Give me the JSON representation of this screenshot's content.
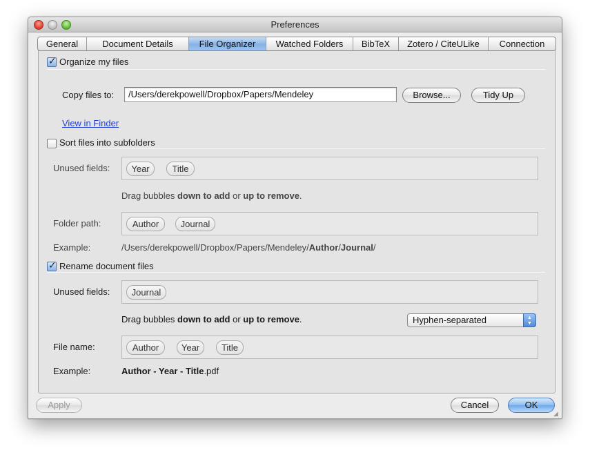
{
  "window": {
    "title": "Preferences"
  },
  "tabs": [
    {
      "label": "General"
    },
    {
      "label": "Document Details"
    },
    {
      "label": "File Organizer",
      "active": true
    },
    {
      "label": "Watched Folders"
    },
    {
      "label": "BibTeX"
    },
    {
      "label": "Zotero / CiteULike"
    },
    {
      "label": "Connection"
    }
  ],
  "organize": {
    "checkbox_label": "Organize my files",
    "checked": true,
    "copy_label": "Copy files to:",
    "copy_path": "/Users/derekpowell/Dropbox/Papers/Mendeley",
    "browse_label": "Browse...",
    "tidy_label": "Tidy Up",
    "view_link": "View in Finder"
  },
  "sort": {
    "checkbox_label": "Sort files into subfolders",
    "checked": false,
    "unused_label": "Unused fields:",
    "unused_fields": [
      "Year",
      "Title"
    ],
    "hint_prefix": "Drag bubbles ",
    "hint_add": "down to add",
    "hint_mid": " or ",
    "hint_remove": "up to remove",
    "hint_end": ".",
    "path_label": "Folder path:",
    "path_fields": [
      "Author",
      "Journal"
    ],
    "example_label": "Example:",
    "example_base": "/Users/derekpowell/Dropbox/Papers/Mendeley/",
    "example_author": "Author",
    "example_sep": "/",
    "example_journal": "Journal",
    "example_end": "/"
  },
  "rename": {
    "checkbox_label": "Rename document files",
    "checked": true,
    "unused_label": "Unused fields:",
    "unused_fields": [
      "Journal"
    ],
    "hint_prefix": "Drag bubbles ",
    "hint_add": "down to add",
    "hint_mid": " or ",
    "hint_remove": "up to remove",
    "hint_end": ".",
    "separator_value": "Hyphen-separated",
    "filename_label": "File name:",
    "filename_fields": [
      "Author",
      "Year",
      "Title"
    ],
    "example_label": "Example:",
    "example_bold": "Author - Year - Title",
    "example_ext": ".pdf"
  },
  "footer": {
    "apply_label": "Apply",
    "cancel_label": "Cancel",
    "ok_label": "OK"
  },
  "colors": {
    "tab_active": "#9dc2ef",
    "link": "#1f3fd0",
    "default_button": "#6ea9ec"
  },
  "icons": {
    "stepper": "up-down-arrows-icon",
    "check": "checkmark-icon",
    "resize": "resize-grip-icon"
  }
}
